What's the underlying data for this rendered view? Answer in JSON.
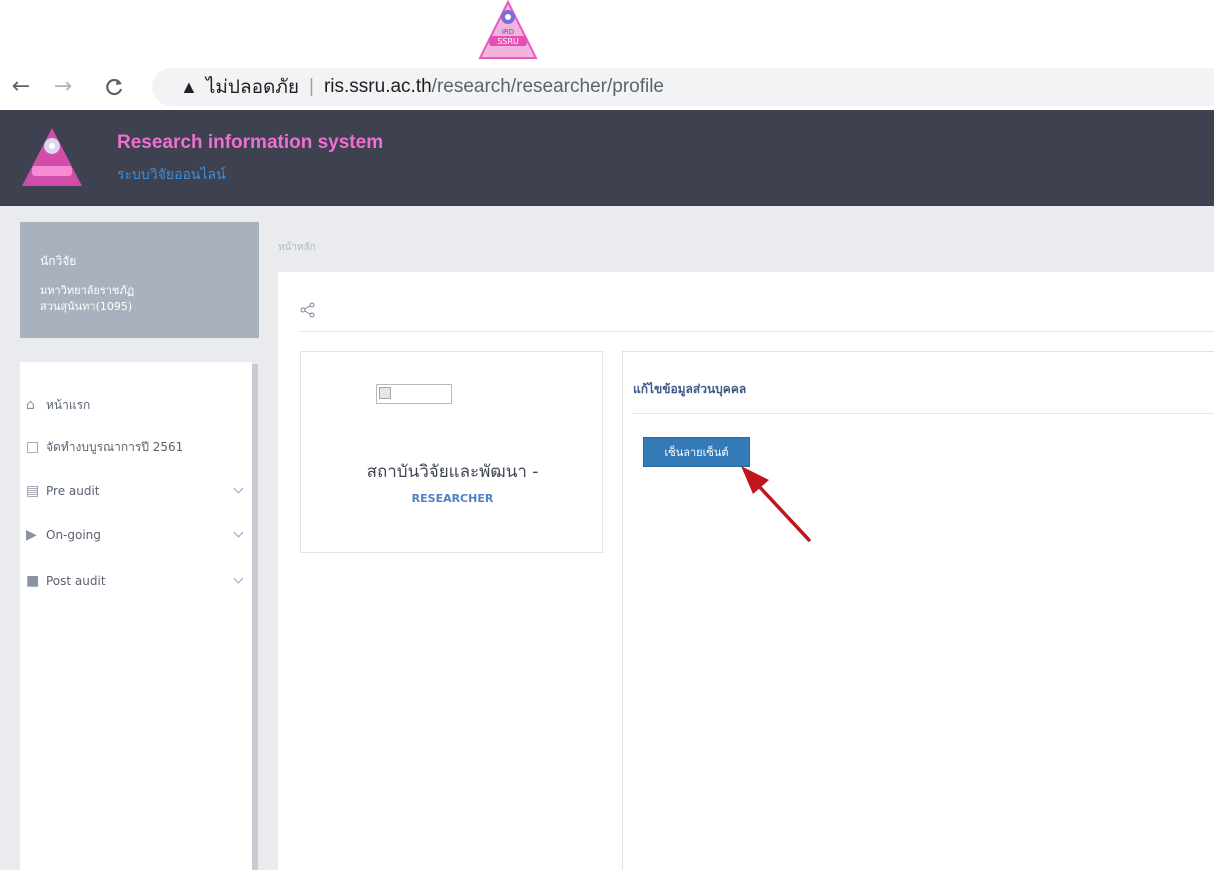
{
  "browser": {
    "warning_label": "ไม่ปลอดภัย",
    "url_host": "ris.ssru.ac.th",
    "url_path": "/research/researcher/profile",
    "back_icon": "arrow-left-icon",
    "forward_icon": "arrow-right-icon",
    "reload_icon": "reload-icon"
  },
  "header": {
    "title": "Research information system",
    "subtitle": "ระบบวิจัยออนไลน์",
    "title_color": "#ef6fd0",
    "subtitle_color": "#3b8fd9",
    "background": "#3d4150"
  },
  "user": {
    "role": "นักวิจัย",
    "organization": "มหาวิทยาลัยราชภัฏสวนสุนันทา(1095)"
  },
  "sidebar": {
    "items": [
      {
        "label": "หน้าแรก",
        "icon": "home-icon"
      },
      {
        "label": "จัดทำงบบูรณาการปี 2561",
        "icon": "bookmark-icon"
      },
      {
        "label": "Pre audit",
        "icon": "document-icon"
      },
      {
        "label": "On-going",
        "icon": "play-icon"
      },
      {
        "label": "Post audit",
        "icon": "file-icon"
      }
    ]
  },
  "breadcrumb": "หน้าหลัก",
  "profile": {
    "name": "สถาบันวิจัยและพัฒนา -",
    "role": "RESEARCHER"
  },
  "edit": {
    "title": "แก้ไขข้อมูลส่วนบุคคล",
    "button_label": "เซ็นลายเซ็นต์",
    "button_color": "#337ab7"
  }
}
